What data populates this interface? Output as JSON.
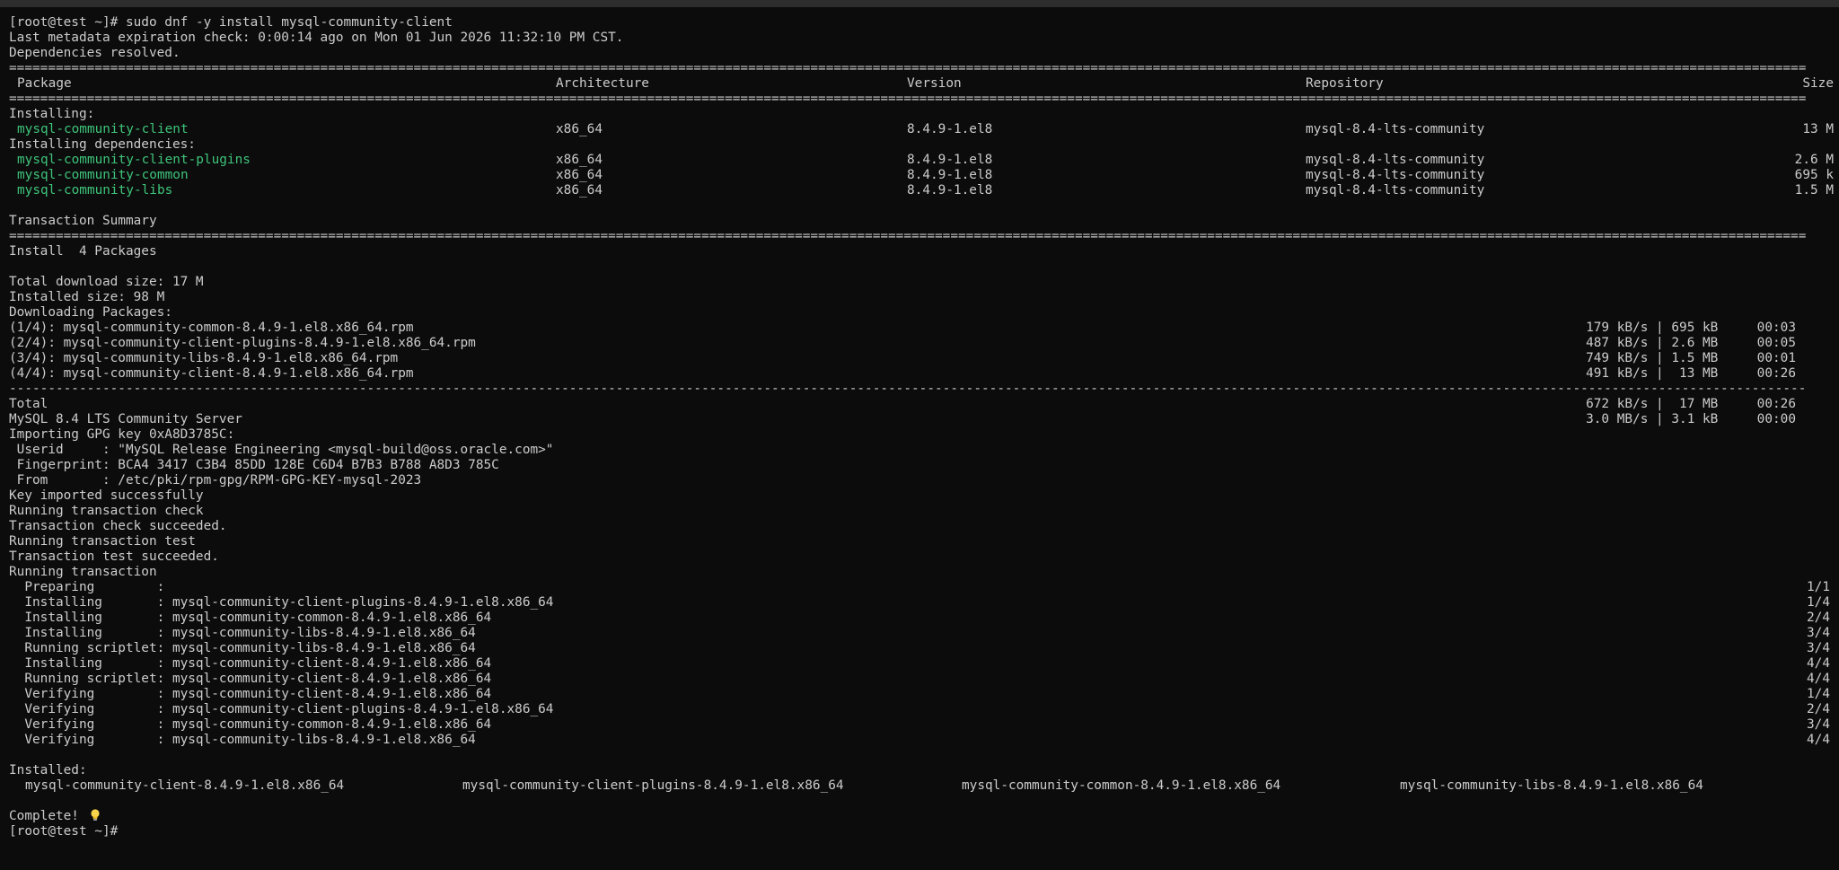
{
  "prompt": "[root@test ~]#",
  "command": "sudo dnf -y install mysql-community-client",
  "meta_line": "Last metadata expiration check: 0:00:14 ago on Mon 01 Jun 2026 11:32:10 PM CST.",
  "deps_resolved": "Dependencies resolved.",
  "rule_eq": "=======================================================================================================================================================================================================================================",
  "rule_dash": "---------------------------------------------------------------------------------------------------------------------------------------------------------------------------------------------------------------------------------------",
  "table": {
    "headers": {
      "package": "Package",
      "arch": "Architecture",
      "version": "Version",
      "repo": "Repository",
      "size": "Size"
    },
    "installing_label": "Installing:",
    "installing": [
      {
        "name": "mysql-community-client",
        "arch": "x86_64",
        "version": "8.4.9-1.el8",
        "repo": "mysql-8.4-lts-community",
        "size": "13 M"
      }
    ],
    "deps_label": "Installing dependencies:",
    "deps": [
      {
        "name": "mysql-community-client-plugins",
        "arch": "x86_64",
        "version": "8.4.9-1.el8",
        "repo": "mysql-8.4-lts-community",
        "size": "2.6 M"
      },
      {
        "name": "mysql-community-common",
        "arch": "x86_64",
        "version": "8.4.9-1.el8",
        "repo": "mysql-8.4-lts-community",
        "size": "695 k"
      },
      {
        "name": "mysql-community-libs",
        "arch": "x86_64",
        "version": "8.4.9-1.el8",
        "repo": "mysql-8.4-lts-community",
        "size": "1.5 M"
      }
    ]
  },
  "summary_title": "Transaction Summary",
  "install_count": "Install  4 Packages",
  "total_download": "Total download size: 17 M",
  "installed_size": "Installed size: 98 M",
  "downloading": "Downloading Packages:",
  "downloads": [
    {
      "file": "(1/4): mysql-community-common-8.4.9-1.el8.x86_64.rpm",
      "stats": "179 kB/s | 695 kB     00:03"
    },
    {
      "file": "(2/4): mysql-community-client-plugins-8.4.9-1.el8.x86_64.rpm",
      "stats": "487 kB/s | 2.6 MB     00:05"
    },
    {
      "file": "(3/4): mysql-community-libs-8.4.9-1.el8.x86_64.rpm",
      "stats": "749 kB/s | 1.5 MB     00:01"
    },
    {
      "file": "(4/4): mysql-community-client-8.4.9-1.el8.x86_64.rpm",
      "stats": "491 kB/s |  13 MB     00:26"
    }
  ],
  "total": {
    "label": "Total",
    "stats": "672 kB/s |  17 MB     00:26"
  },
  "server": {
    "label": "MySQL 8.4 LTS Community Server",
    "stats": "3.0 MB/s | 3.1 kB     00:00"
  },
  "gpg_lines": [
    "Importing GPG key 0xA8D3785C:",
    " Userid     : \"MySQL Release Engineering <mysql-build@oss.oracle.com>\"",
    " Fingerprint: BCA4 3417 C3B4 85DD 128E C6D4 B7B3 B788 A8D3 785C",
    " From       : /etc/pki/rpm-gpg/RPM-GPG-KEY-mysql-2023",
    "Key imported successfully",
    "Running transaction check",
    "Transaction check succeeded.",
    "Running transaction test",
    "Transaction test succeeded.",
    "Running transaction"
  ],
  "steps": [
    {
      "text": "  Preparing        :",
      "count": "1/1"
    },
    {
      "text": "  Installing       : mysql-community-client-plugins-8.4.9-1.el8.x86_64",
      "count": "1/4"
    },
    {
      "text": "  Installing       : mysql-community-common-8.4.9-1.el8.x86_64",
      "count": "2/4"
    },
    {
      "text": "  Installing       : mysql-community-libs-8.4.9-1.el8.x86_64",
      "count": "3/4"
    },
    {
      "text": "  Running scriptlet: mysql-community-libs-8.4.9-1.el8.x86_64",
      "count": "3/4"
    },
    {
      "text": "  Installing       : mysql-community-client-8.4.9-1.el8.x86_64",
      "count": "4/4"
    },
    {
      "text": "  Running scriptlet: mysql-community-client-8.4.9-1.el8.x86_64",
      "count": "4/4"
    },
    {
      "text": "  Verifying        : mysql-community-client-8.4.9-1.el8.x86_64",
      "count": "1/4"
    },
    {
      "text": "  Verifying        : mysql-community-client-plugins-8.4.9-1.el8.x86_64",
      "count": "2/4"
    },
    {
      "text": "  Verifying        : mysql-community-common-8.4.9-1.el8.x86_64",
      "count": "3/4"
    },
    {
      "text": "  Verifying        : mysql-community-libs-8.4.9-1.el8.x86_64",
      "count": "4/4"
    }
  ],
  "installed_label": "Installed:",
  "installed": [
    "mysql-community-client-8.4.9-1.el8.x86_64",
    "mysql-community-client-plugins-8.4.9-1.el8.x86_64",
    "mysql-community-common-8.4.9-1.el8.x86_64",
    "mysql-community-libs-8.4.9-1.el8.x86_64"
  ],
  "complete": "Complete!",
  "complete_icon": "lightbulb-icon",
  "colors": {
    "background": "#0c0c0c",
    "text": "#cccccc",
    "package_green": "#3ec47a"
  }
}
